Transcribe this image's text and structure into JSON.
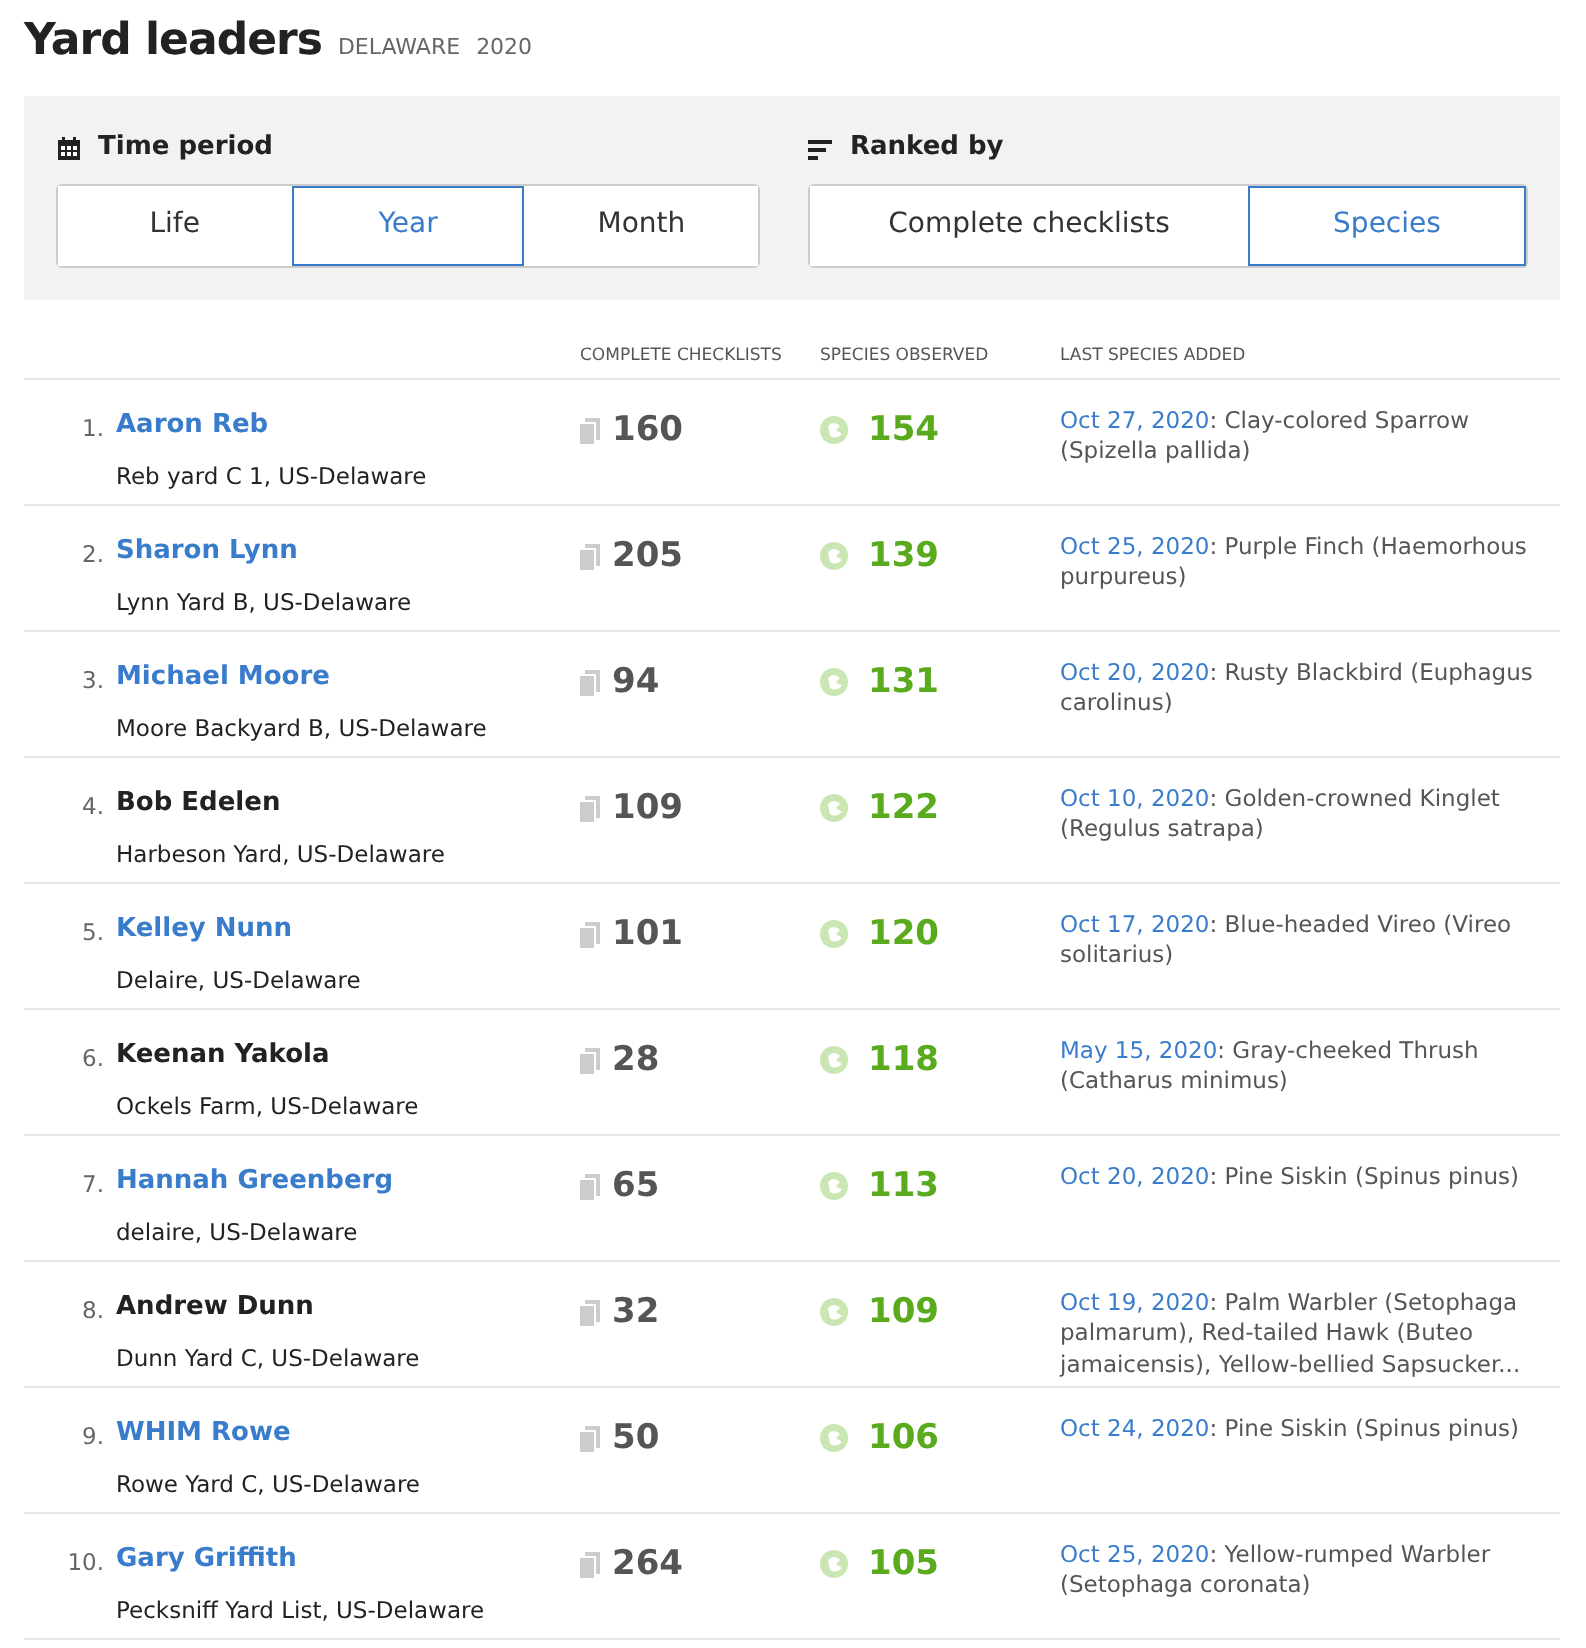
{
  "title": "Yard leaders",
  "region": "DELAWARE",
  "year": "2020",
  "filters": [
    {
      "kind": "calendar",
      "label": "Time period",
      "options": [
        {
          "label": "Life",
          "selected": false
        },
        {
          "label": "Year",
          "selected": true
        },
        {
          "label": "Month",
          "selected": false
        }
      ]
    },
    {
      "kind": "sort",
      "label": "Ranked by",
      "options": [
        {
          "label": "Complete checklists",
          "selected": false
        },
        {
          "label": "Species",
          "selected": true
        }
      ]
    }
  ],
  "columns": [
    "COMPLETE CHECKLISTS",
    "SPECIES OBSERVED",
    "LAST SPECIES ADDED"
  ],
  "rows": [
    {
      "rank": "1.",
      "name": "Aaron Reb",
      "linked": true,
      "location": "Reb yard C 1, US-Delaware",
      "checklists": "160",
      "species": "154",
      "date": "Oct 27, 2020",
      "last": ": Clay-colored Sparrow (Spizella pallida)"
    },
    {
      "rank": "2.",
      "name": "Sharon Lynn",
      "linked": true,
      "location": "Lynn Yard B, US-Delaware",
      "checklists": "205",
      "species": "139",
      "date": "Oct 25, 2020",
      "last": ": Purple Finch (Haemorhous purpureus)"
    },
    {
      "rank": "3.",
      "name": "Michael Moore",
      "linked": true,
      "location": "Moore Backyard B, US-Delaware",
      "checklists": "94",
      "species": "131",
      "date": "Oct 20, 2020",
      "last": ": Rusty Blackbird (Euphagus carolinus)"
    },
    {
      "rank": "4.",
      "name": "Bob Edelen",
      "linked": false,
      "location": "Harbeson Yard, US-Delaware",
      "checklists": "109",
      "species": "122",
      "date": "Oct 10, 2020",
      "last": ": Golden-crowned Kinglet (Regulus satrapa)"
    },
    {
      "rank": "5.",
      "name": "Kelley Nunn",
      "linked": true,
      "location": "Delaire, US-Delaware",
      "checklists": "101",
      "species": "120",
      "date": "Oct 17, 2020",
      "last": ": Blue-headed Vireo (Vireo solitarius)"
    },
    {
      "rank": "6.",
      "name": "Keenan Yakola",
      "linked": false,
      "location": "Ockels Farm, US-Delaware",
      "checklists": "28",
      "species": "118",
      "date": "May 15, 2020",
      "last": ": Gray-cheeked Thrush (Catharus minimus)"
    },
    {
      "rank": "7.",
      "name": "Hannah Greenberg",
      "linked": true,
      "location": "delaire, US-Delaware",
      "checklists": "65",
      "species": "113",
      "date": "Oct 20, 2020",
      "last": ": Pine Siskin (Spinus pinus)"
    },
    {
      "rank": "8.",
      "name": "Andrew Dunn",
      "linked": false,
      "location": "Dunn Yard C, US-Delaware",
      "checklists": "32",
      "species": "109",
      "date": "Oct 19, 2020",
      "last": ": Palm Warbler (Setophaga palmarum), Red-tailed Hawk (Buteo jamaicensis), Yellow-bellied Sapsucker..."
    },
    {
      "rank": "9.",
      "name": "WHIM Rowe",
      "linked": true,
      "location": "Rowe Yard C, US-Delaware",
      "checklists": "50",
      "species": "106",
      "date": "Oct 24, 2020",
      "last": ": Pine Siskin (Spinus pinus)"
    },
    {
      "rank": "10.",
      "name": "Gary Griffith",
      "linked": true,
      "location": "Pecksniff Yard List, US-Delaware",
      "checklists": "264",
      "species": "105",
      "date": "Oct 25, 2020",
      "last": ": Yellow-rumped Warbler (Setophaga coronata)"
    }
  ]
}
